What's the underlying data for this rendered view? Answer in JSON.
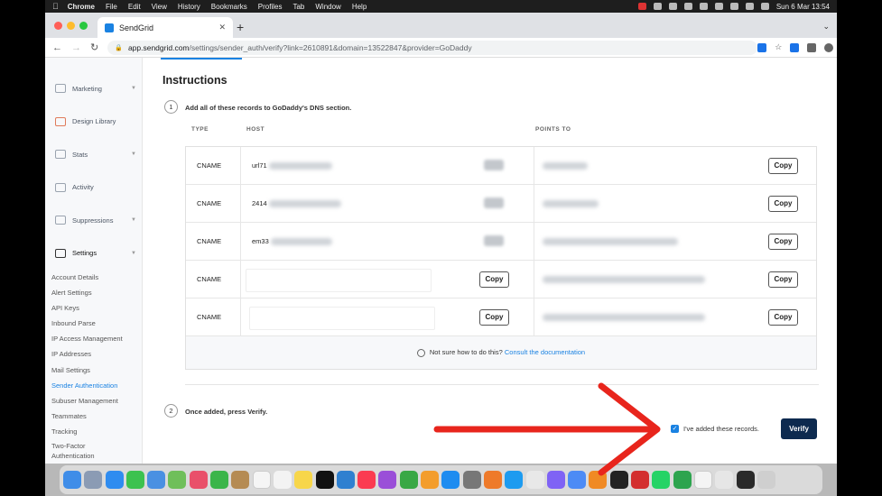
{
  "menubar": {
    "app_name": "Chrome",
    "items": [
      "File",
      "Edit",
      "View",
      "History",
      "Bookmarks",
      "Profiles",
      "Tab",
      "Window",
      "Help"
    ],
    "clock": "Sun 6 Mar  13:54"
  },
  "browser": {
    "tab_title": "SendGrid",
    "url_host": "app.sendgrid.com",
    "url_path": "/settings/sender_auth/verify?link=2610891&domain=13522847&provider=GoDaddy"
  },
  "sidebar": {
    "main_items": [
      {
        "label": "Marketing"
      },
      {
        "label": "Design Library"
      },
      {
        "label": "Stats"
      },
      {
        "label": "Activity"
      },
      {
        "label": "Suppressions"
      },
      {
        "label": "Settings"
      }
    ],
    "sub_items": [
      "Account Details",
      "Alert Settings",
      "API Keys",
      "Inbound Parse",
      "IP Access Management",
      "IP Addresses",
      "Mail Settings",
      "Sender Authentication",
      "Subuser Management",
      "Teammates",
      "Tracking"
    ],
    "last_item_line1": "Two-Factor",
    "last_item_line2": "Authentication"
  },
  "main": {
    "title": "Instructions",
    "step1_number": "1",
    "step1_text": "Add all of these records to GoDaddy's DNS section.",
    "headers": {
      "type": "TYPE",
      "host": "HOST",
      "points_to": "POINTS TO"
    },
    "records": [
      {
        "type": "CNAME",
        "host": "url71"
      },
      {
        "type": "CNAME",
        "host": "2414"
      },
      {
        "type": "CNAME",
        "host": "em33"
      },
      {
        "type": "CNAME",
        "host": ""
      },
      {
        "type": "CNAME",
        "host": ""
      }
    ],
    "copy_label": "Copy",
    "help_text": "Not sure how to do this?",
    "help_link": "Consult the documentation",
    "step2_number": "2",
    "step2_text": "Once added, press Verify.",
    "checkbox_label": "I've added these records.",
    "verify_label": "Verify"
  },
  "colors": {
    "accent": "#1a82e2",
    "verify_bg": "#0d2a4f",
    "arrow": "#e8251c"
  }
}
